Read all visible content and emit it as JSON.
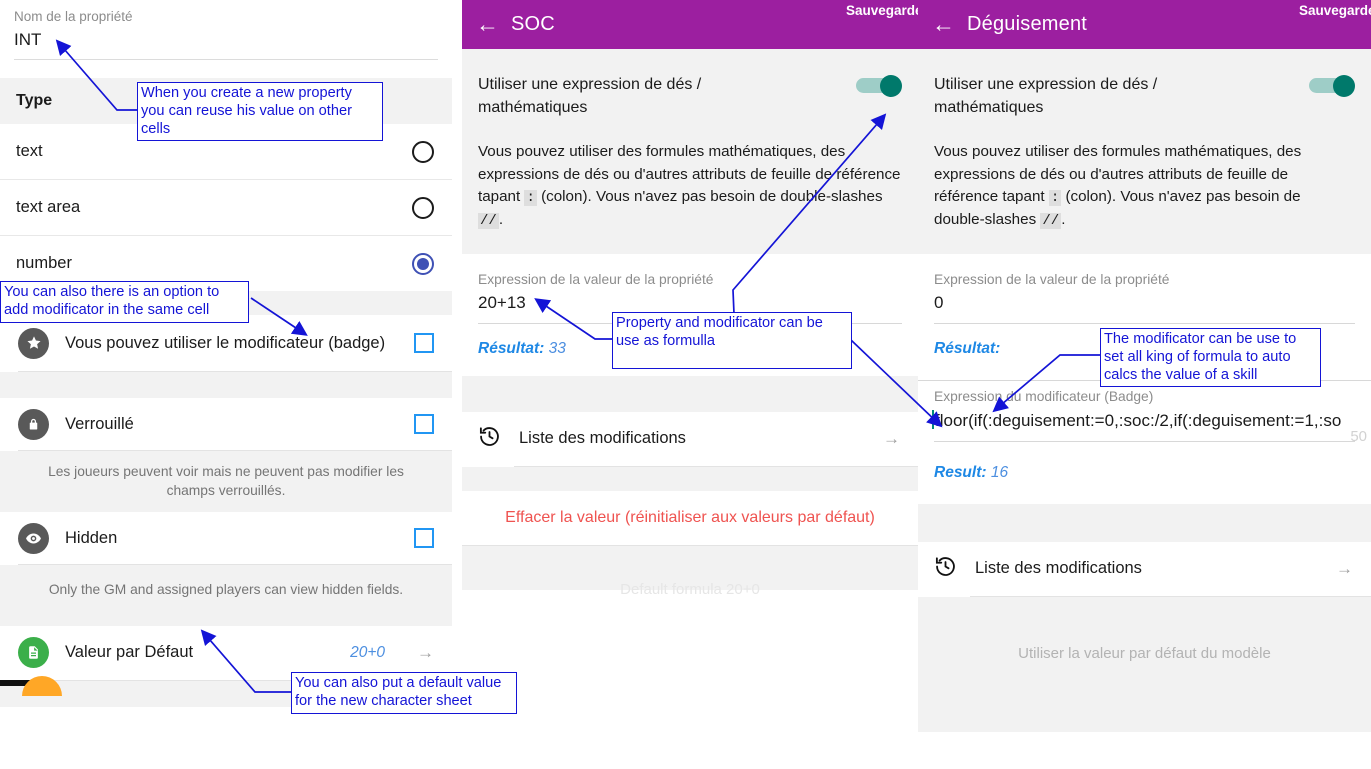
{
  "left_panel": {
    "property_name_label": "Nom de la propriété",
    "property_name_value": "INT",
    "type_section_title": "Type",
    "type_options": [
      {
        "label": "text",
        "selected": false
      },
      {
        "label": "text area",
        "selected": false
      },
      {
        "label": "number",
        "selected": true
      }
    ],
    "badge_row": {
      "icon": "star-icon",
      "label": "Vous pouvez utiliser le modificateur (badge)",
      "checked": false
    },
    "locked_row": {
      "icon": "lock-icon",
      "label": "Verrouillé",
      "checked": false
    },
    "locked_helper": "Les joueurs peuvent voir mais ne peuvent pas modifier les champs verrouillés.",
    "hidden_row": {
      "icon": "eye-icon",
      "label": "Hidden",
      "checked": false
    },
    "hidden_helper": "Only the GM and assigned players can view hidden fields.",
    "default_value_row": {
      "icon": "document-icon",
      "label": "Valeur par Défaut",
      "value": "20+0",
      "chevron": "arrow-right-icon"
    }
  },
  "mid_panel": {
    "appbar": {
      "back": "back-arrow-icon",
      "title": "SOC",
      "save_label": "Sauvegarder"
    },
    "dice_toggle_label": "Utiliser une expression de dés / mathématiques",
    "dice_toggle_on": true,
    "paragraph_part1": "Vous pouvez utiliser des formules mathématiques, des expressions de dés ou d'autres attributs de feuille de référence tapant ",
    "paragraph_code1": ":",
    "paragraph_part2": " (colon). Vous n'avez pas besoin de double-slashes ",
    "paragraph_code2": "//",
    "paragraph_part3": ".",
    "expression_label": "Expression de la valeur de la propriété",
    "expression_value": "20+13",
    "result_label": "Résultat:",
    "result_value": "33",
    "modifications_row": {
      "icon": "history-icon",
      "label": "Liste des modifications",
      "chevron": "arrow-right-icon"
    },
    "clear_value_label": "Effacer la valeur (réinitialiser aux valeurs par défaut)"
  },
  "right_panel": {
    "appbar": {
      "back": "back-arrow-icon",
      "title": "Déguisement",
      "save_label": "Sauvegarder"
    },
    "dice_toggle_label": "Utiliser une expression de dés / mathématiques",
    "dice_toggle_on": true,
    "paragraph_part1": "Vous pouvez utiliser des formules mathématiques, des expressions de dés ou d'autres attributs de feuille de référence tapant ",
    "paragraph_code1": ":",
    "paragraph_part2": " (colon). Vous n'avez pas besoin de double-slashes ",
    "paragraph_code2": "//",
    "paragraph_part3": ".",
    "expression_label": "Expression de la valeur de la propriété",
    "expression_value": "0",
    "result_label": "Résultat:",
    "result_value": "",
    "modifier_label": "Expression du modificateur (Badge)",
    "modifier_value": "floor(if(:deguisement:=0,:soc:/2,if(:deguisement:=1,:so",
    "modifier_charcount": "50",
    "result2_label": "Result:",
    "result2_value": "16",
    "modifications_row": {
      "icon": "history-icon",
      "label": "Liste des modifications",
      "chevron": "arrow-right-icon"
    },
    "template_default_placeholder": "Utiliser la valeur par défaut du modèle"
  },
  "annotations": [
    {
      "id": "a1",
      "text": "When you create a new property you can reuse his value on other cells"
    },
    {
      "id": "a2",
      "text": "You can also there is an option to add modificator in the same cell"
    },
    {
      "id": "a3",
      "text": "You can also put a default value for the new character sheet"
    },
    {
      "id": "a4",
      "text": "Property and modificator can be use as formulla"
    },
    {
      "id": "a5",
      "text": "The modificator can be use to set all king of formula to auto calcs the value of a skill"
    }
  ],
  "colors": {
    "appbar_purple": "#9C1FA0",
    "toggle_teal": "#00796B",
    "checkbox_blue": "#2196F3",
    "radio_indigo": "#3F51B5",
    "annotation_blue": "#1414D6",
    "danger_red": "#EF5350",
    "value_blue": "#4D8FE0"
  }
}
